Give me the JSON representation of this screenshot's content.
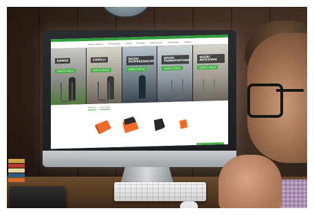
{
  "nav": {
    "items": [
      "Strona główna",
      "Prezentacja",
      "Sklep",
      "Kontakt",
      "Reklamacje",
      "Informacje",
      "Szukaj"
    ]
  },
  "hero": {
    "panels": [
      {
        "label": "KAMOE",
        "cta": "ZOBACZ WIĘCEJ"
      },
      {
        "label": "CHWILLI",
        "cta": "ZOBACZ WIĘCEJ"
      },
      {
        "label": "WÓZKI PROFESJONALNE",
        "cta": "ZOBACZ WIĘCEJ"
      },
      {
        "label": "WÓZKI TRANSPORTOWE",
        "cta": "ZOBACZ WIĘCEJ"
      },
      {
        "label": "WÓZKI AKCESORIA",
        "cta": "ZOBACZ WIĘCEJ"
      }
    ]
  },
  "tabs": [
    "Nowości",
    "Popularne"
  ],
  "colors": {
    "accent_green": "#43b043",
    "product_orange": "#f06a2a"
  }
}
